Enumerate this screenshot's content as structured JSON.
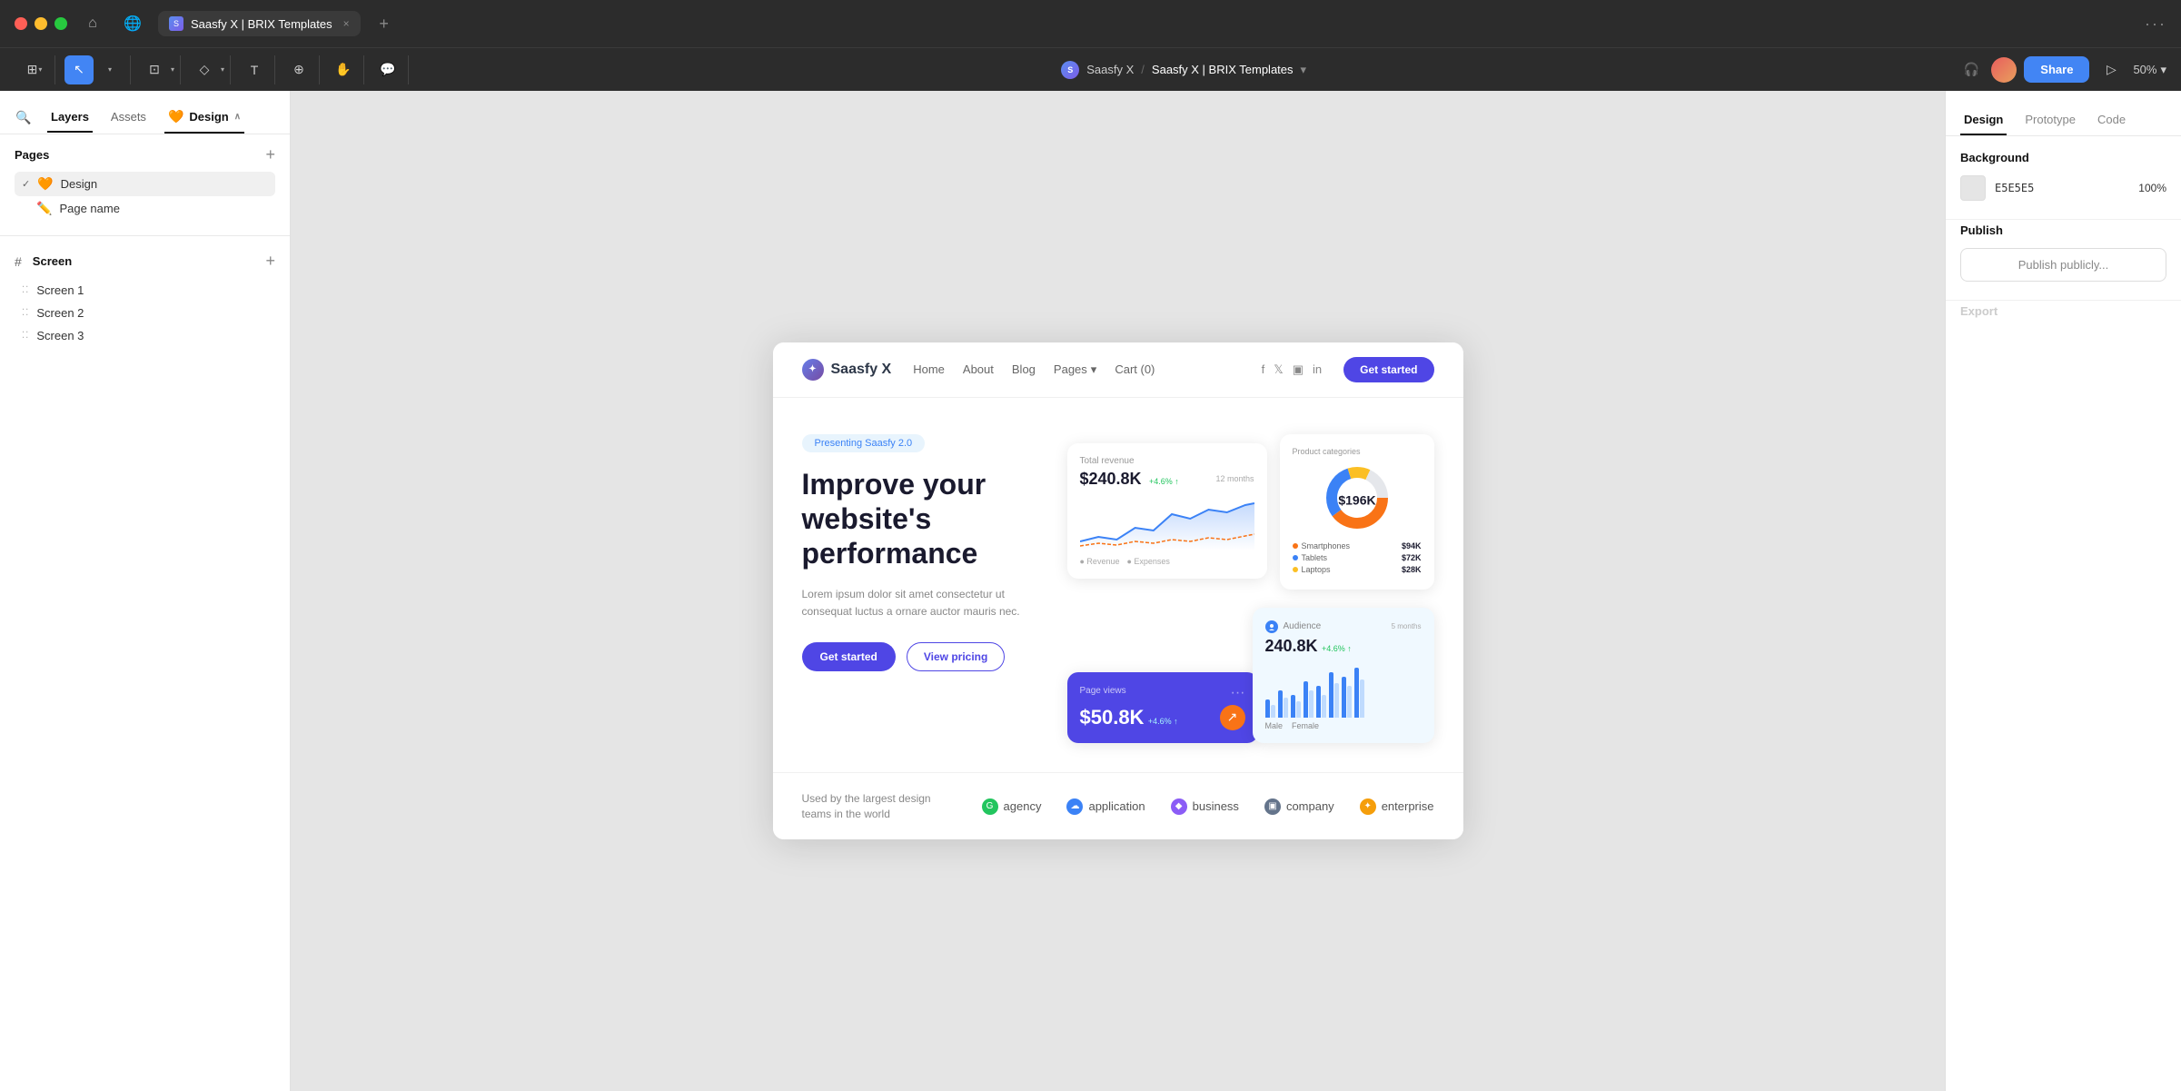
{
  "titlebar": {
    "tab_name": "Saasfy X | BRIX Templates",
    "tab_close": "×",
    "tab_add": "+",
    "more": "···",
    "home_icon": "⌂",
    "globe_icon": "🌐"
  },
  "toolbar": {
    "breadcrumb_logo": "S",
    "project_name": "Saasfy X",
    "separator": "/",
    "page_name": "Saasfy X | BRIX Templates",
    "dropdown_arrow": "▾",
    "share_label": "Share",
    "zoom_label": "50%"
  },
  "left_sidebar": {
    "search_icon": "🔍",
    "layers_tab": "Layers",
    "assets_tab": "Assets",
    "design_tab": "Design",
    "design_emoji": "🧡",
    "design_arrow": "∧",
    "pages_title": "Pages",
    "pages_add": "+",
    "page_design": "Design",
    "page_design_emoji": "🧡",
    "page_design_check": "✓",
    "page_name_item": "Page name",
    "page_name_emoji": "✏️",
    "screen_title": "Screen",
    "screen_add": "+",
    "screens": [
      "Screen 1",
      "Screen 2",
      "Screen 3"
    ]
  },
  "website": {
    "logo_text": "Saasfy X",
    "nav_home": "Home",
    "nav_about": "About",
    "nav_blog": "Blog",
    "nav_pages": "Pages",
    "nav_pages_arrow": "▾",
    "nav_cart": "Cart (0)",
    "nav_cta": "Get started",
    "hero_badge": "Presenting Saasfy 2.0",
    "hero_title": "Improve your website's performance",
    "hero_desc": "Lorem ipsum dolor sit amet consectetur ut consequat luctus a ornare auctor mauris nec.",
    "btn_primary": "Get started",
    "btn_secondary": "View pricing",
    "card_revenue_label": "Total revenue",
    "card_revenue_value": "$240.8K",
    "card_revenue_change": "+4.6% ↑",
    "card_revenue_period": "12 months",
    "card_donut_title": "Product categories",
    "card_donut_value": "$196K",
    "donut_items": [
      {
        "name": "Smartphones",
        "value": "$94K",
        "color": "#f97316"
      },
      {
        "name": "Tablets",
        "value": "$72K",
        "color": "#3b82f6"
      },
      {
        "name": "Laptops",
        "value": "$28K",
        "color": "#fbbf24"
      }
    ],
    "card_pv_label": "Page views",
    "card_pv_value": "$50.8K",
    "card_pv_change": "+4.6% ↑",
    "card_audience_label": "Audience",
    "card_audience_value": "240.8K",
    "card_audience_change": "+4.6% ↑",
    "card_audience_period": "5 months",
    "bar_legend_male": "Male",
    "bar_legend_female": "Female",
    "logos_label": "Used by the largest design teams in the world",
    "logos": [
      {
        "name": "agency",
        "icon": "G"
      },
      {
        "name": "application",
        "icon": "☁"
      },
      {
        "name": "business",
        "icon": "◆"
      },
      {
        "name": "company",
        "icon": "▣"
      },
      {
        "name": "enterprise",
        "icon": "✦"
      }
    ]
  },
  "right_sidebar": {
    "design_tab": "Design",
    "prototype_tab": "Prototype",
    "code_tab": "Code",
    "background_title": "Background",
    "bg_color": "E5E5E5",
    "bg_opacity": "100%",
    "publish_title": "Publish",
    "publish_btn": "Publish publicly...",
    "export_title": "Export"
  }
}
